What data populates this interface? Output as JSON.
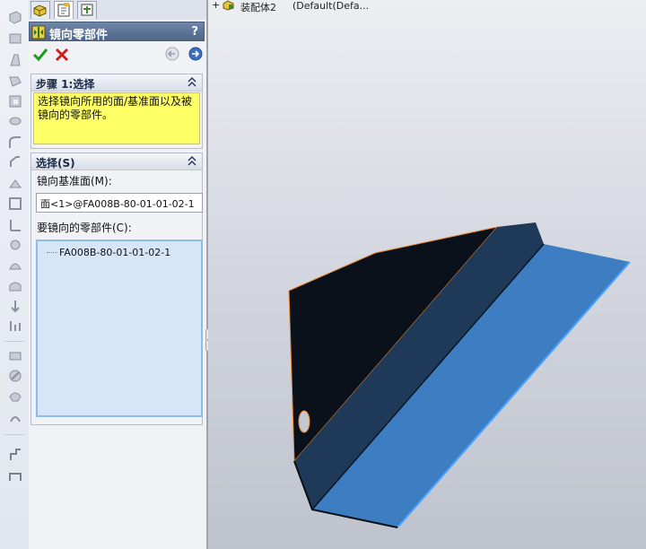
{
  "panel": {
    "title": "镜向零部件",
    "help": "?",
    "tabs": [
      "featuremanager-tab",
      "propertymanager-tab",
      "configurationmanager-tab"
    ],
    "step": {
      "title": "步骤 1:选择",
      "note": "选择镜向所用的面/基准面以及被镜向的零部件。"
    },
    "selection": {
      "title": "选择(S)",
      "plane_label": "镜向基准面(M):",
      "plane_value": "面<1>@FA008B-80-01-01-02-1",
      "components_label": "要镜向的零部件(C):",
      "components": [
        "FA008B-80-01-01-02-1"
      ]
    }
  },
  "viewport": {
    "tree": {
      "expander": "+",
      "assembly_name": "装配体2",
      "config": "(Default(Defa..."
    }
  },
  "colors": {
    "accent_title": "#5a7094",
    "note_bg": "#ffff66",
    "list_bg": "#d6e6f8",
    "model_face_dark": "#0b111a",
    "model_face_mid": "#1e3a58",
    "model_face_light": "#3d7dc2",
    "highlight_edge": "#f08a2a"
  }
}
